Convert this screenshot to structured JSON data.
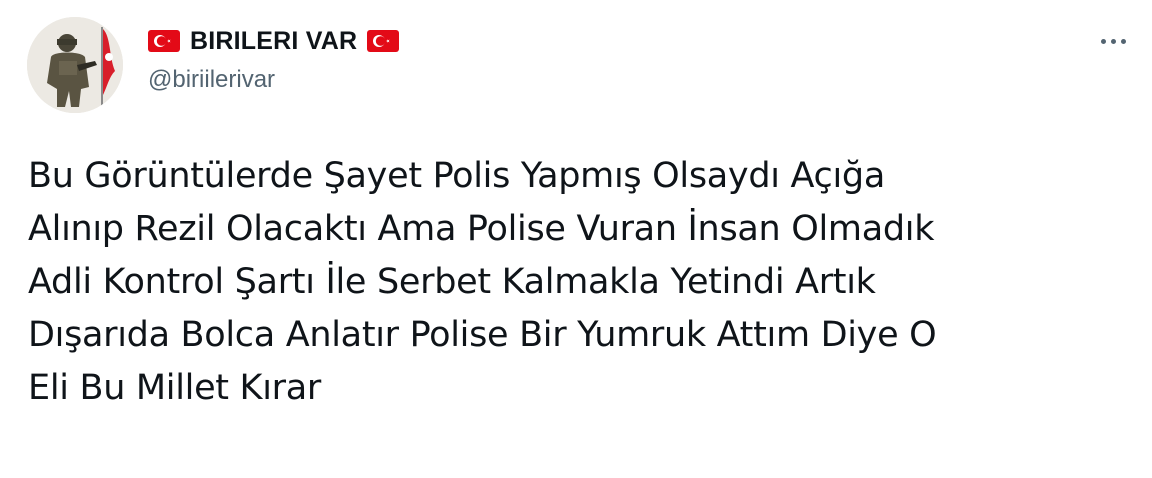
{
  "author": {
    "display_name": "BIRILERI VAR",
    "handle": "@biriilerivar",
    "flag_icon": "turkish-flag-icon",
    "flag_colors": {
      "red": "#e30a17",
      "white": "#ffffff"
    }
  },
  "menu": {
    "icon": "more-options-icon"
  },
  "tweet": {
    "text_lines": [
      "Bu Görüntülerde Şayet Polis Yapmış Olsaydı Açığa",
      "Alınıp Rezil Olacaktı Ama Polise Vuran İnsan Olmadık",
      "Adli Kontrol Şartı İle Serbet Kalmakla Yetindi Artık",
      "Dışarıda Bolca Anlatır Polise Bir Yumruk Attım Diye O",
      "Eli Bu Millet Kırar"
    ]
  },
  "colors": {
    "text_primary": "#0f1419",
    "text_secondary": "#536471",
    "background": "#ffffff"
  }
}
